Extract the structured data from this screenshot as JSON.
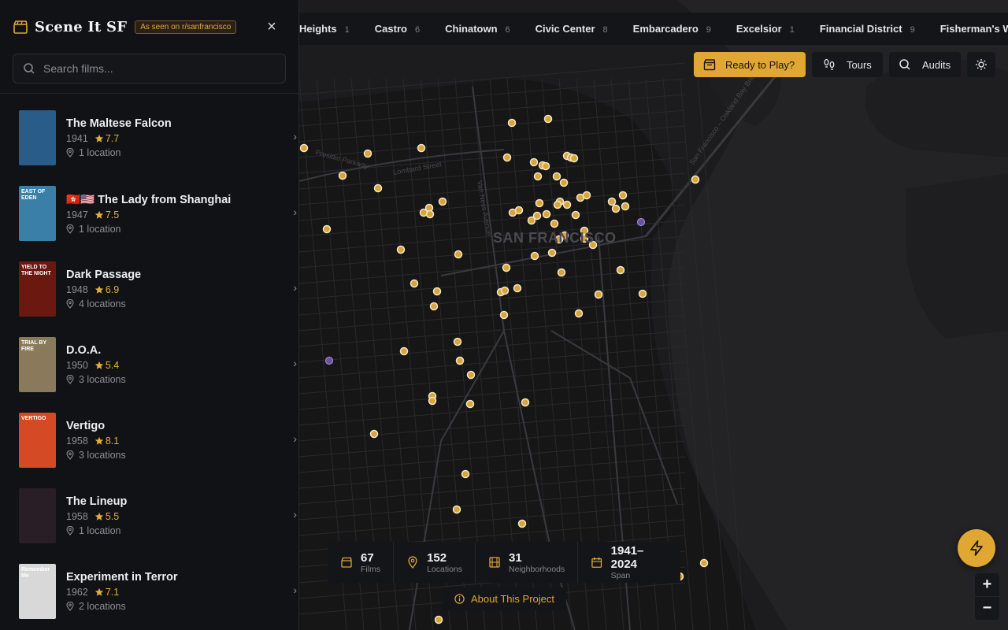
{
  "app": {
    "title": "Scene It SF",
    "badge": "As seen on r/sanfrancisco",
    "close_icon": "close-icon"
  },
  "search": {
    "placeholder": "Search films..."
  },
  "films": [
    {
      "title": "The Maltese Falcon",
      "year": "1941",
      "rating": "7.7",
      "locations": "1 location",
      "poster_color": "#2a5c8a",
      "poster_text": ""
    },
    {
      "title": "🇭🇰🇺🇸 The Lady from Shanghai",
      "year": "1947",
      "rating": "7.5",
      "locations": "1 location",
      "poster_color": "#3a7fa8",
      "poster_text": "EAST OF EDEN"
    },
    {
      "title": "Dark Passage",
      "year": "1948",
      "rating": "6.9",
      "locations": "4 locations",
      "poster_color": "#6b1810",
      "poster_text": "YIELD TO THE NIGHT"
    },
    {
      "title": "D.O.A.",
      "year": "1950",
      "rating": "5.4",
      "locations": "3 locations",
      "poster_color": "#8a7a5c",
      "poster_text": "TRIAL BY FIRE"
    },
    {
      "title": "Vertigo",
      "year": "1958",
      "rating": "8.1",
      "locations": "3 locations",
      "poster_color": "#d44a24",
      "poster_text": "VERTIGO"
    },
    {
      "title": "The Lineup",
      "year": "1958",
      "rating": "5.5",
      "locations": "1 location",
      "poster_color": "#2a1e26",
      "poster_text": ""
    },
    {
      "title": "Experiment in Terror",
      "year": "1962",
      "rating": "7.1",
      "locations": "2 locations",
      "poster_color": "#d8d8d8",
      "poster_text": "Remember Me"
    }
  ],
  "neighborhoods": [
    {
      "name": "Heights",
      "count": "1"
    },
    {
      "name": "Castro",
      "count": "6"
    },
    {
      "name": "Chinatown",
      "count": "6"
    },
    {
      "name": "Civic Center",
      "count": "8"
    },
    {
      "name": "Embarcadero",
      "count": "9"
    },
    {
      "name": "Excelsior",
      "count": "1"
    },
    {
      "name": "Financial District",
      "count": "9"
    },
    {
      "name": "Fisherman's W",
      "count": ""
    }
  ],
  "controls": {
    "play_label": "Ready to Play?",
    "tours_label": "Tours",
    "audits_label": "Audits"
  },
  "map": {
    "city_label": "SAN FRANCISCO",
    "street_labels": [
      "Lombard Street",
      "Presidio Parkway",
      "Van Ness Avenue",
      "San Francisco – Oakland Bay Bridge"
    ],
    "marker_color": "#d9a53a",
    "alt_marker_color": "#6b4fa0"
  },
  "stats": [
    {
      "value": "67",
      "label": "Films",
      "icon": "clapperboard-icon"
    },
    {
      "value": "152",
      "label": "Locations",
      "icon": "map-pin-icon"
    },
    {
      "value": "31",
      "label": "Neighborhoods",
      "icon": "film-strip-icon"
    },
    {
      "value": "1941–2024",
      "label": "Span",
      "icon": "calendar-icon"
    }
  ],
  "about_label": "About This Project",
  "zoom": {
    "in": "+",
    "out": "−"
  },
  "colors": {
    "accent": "#e0a832",
    "sidebar_bg": "#111216",
    "map_bg": "#1c1c1e"
  }
}
